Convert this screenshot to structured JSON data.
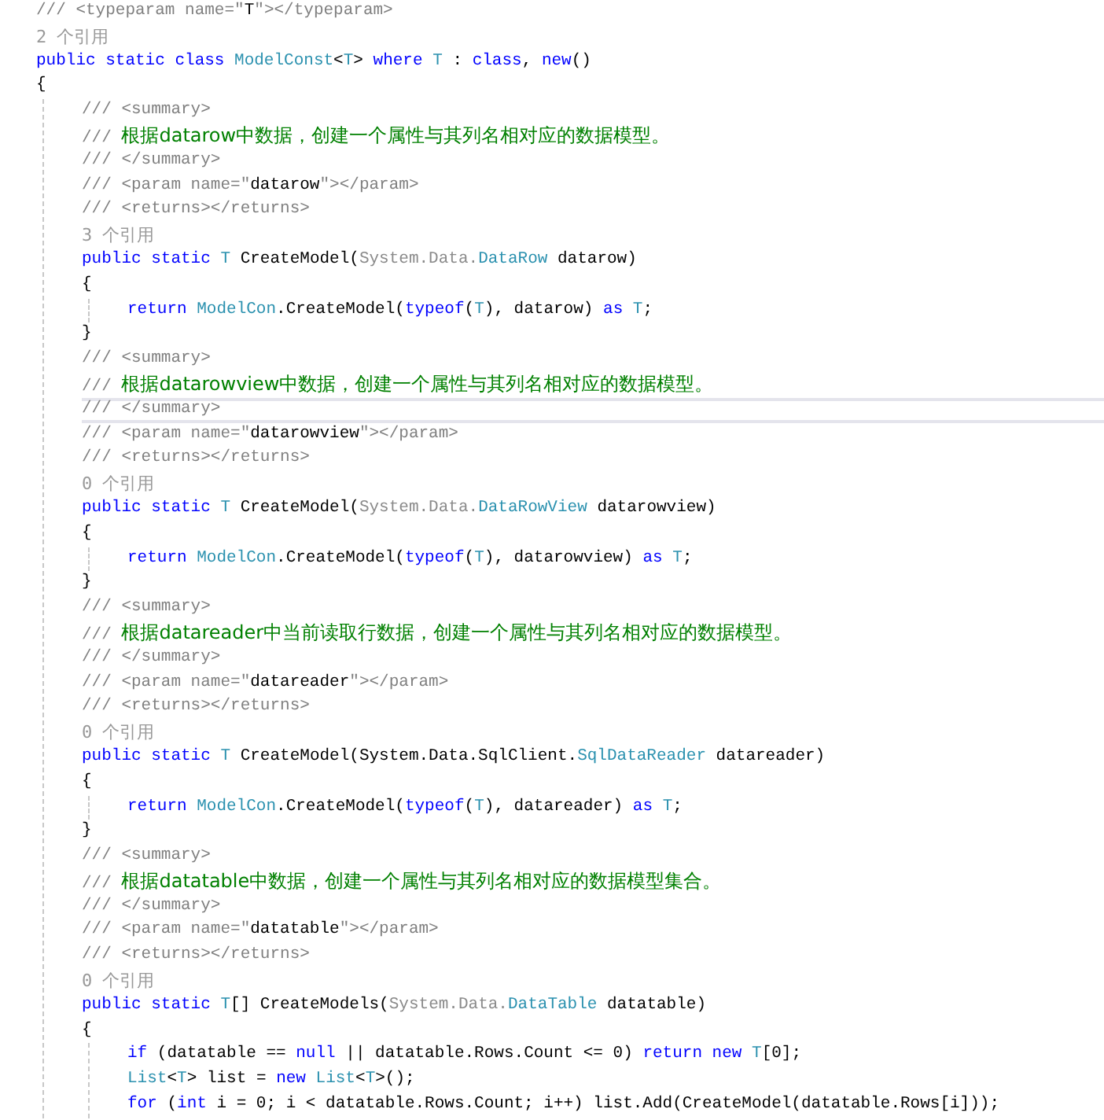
{
  "editor": {
    "lines": [
      {
        "kind": "code",
        "current": false,
        "tokens": [
          {
            "kind": "doc",
            "text": "/// <typeparam name=\""
          },
          {
            "kind": "plain",
            "text": "T"
          },
          {
            "kind": "doc",
            "text": "\"></typeparam>"
          }
        ]
      },
      {
        "kind": "ref",
        "current": false,
        "text": "2 个引用"
      },
      {
        "kind": "code",
        "current": false,
        "tokens": [
          {
            "kind": "kw",
            "text": "public static class "
          },
          {
            "kind": "type",
            "text": "ModelConst"
          },
          {
            "kind": "plain",
            "text": "<"
          },
          {
            "kind": "type",
            "text": "T"
          },
          {
            "kind": "plain",
            "text": "> "
          },
          {
            "kind": "kw",
            "text": "where "
          },
          {
            "kind": "type",
            "text": "T"
          },
          {
            "kind": "plain",
            "text": " : "
          },
          {
            "kind": "kw",
            "text": "class"
          },
          {
            "kind": "plain",
            "text": ", "
          },
          {
            "kind": "kw",
            "text": "new"
          },
          {
            "kind": "plain",
            "text": "()"
          }
        ]
      },
      {
        "kind": "code",
        "current": false,
        "tokens": [
          {
            "kind": "plain",
            "text": "{"
          }
        ]
      },
      {
        "kind": "block",
        "children": [
          {
            "kind": "code",
            "current": false,
            "tokens": [
              {
                "kind": "doc",
                "text": "/// <summary>"
              }
            ]
          },
          {
            "kind": "code",
            "current": false,
            "tokens": [
              {
                "kind": "doc",
                "text": "/// "
              },
              {
                "kind": "comment",
                "text": "根据datarow中数据，创建一个属性与其列名相对应的数据模型。"
              }
            ]
          },
          {
            "kind": "code",
            "current": false,
            "tokens": [
              {
                "kind": "doc",
                "text": "/// </summary>"
              }
            ]
          },
          {
            "kind": "code",
            "current": false,
            "tokens": [
              {
                "kind": "doc",
                "text": "/// <param name=\""
              },
              {
                "kind": "plain",
                "text": "datarow"
              },
              {
                "kind": "doc",
                "text": "\"></param>"
              }
            ]
          },
          {
            "kind": "code",
            "current": false,
            "tokens": [
              {
                "kind": "doc",
                "text": "/// <returns></returns>"
              }
            ]
          },
          {
            "kind": "ref",
            "current": false,
            "text": "3 个引用"
          },
          {
            "kind": "code",
            "current": false,
            "tokens": [
              {
                "kind": "kw",
                "text": "public static "
              },
              {
                "kind": "type",
                "text": "T"
              },
              {
                "kind": "plain",
                "text": " CreateModel("
              },
              {
                "kind": "faded",
                "text": "System.Data."
              },
              {
                "kind": "type",
                "text": "DataRow"
              },
              {
                "kind": "plain",
                "text": " datarow)"
              }
            ]
          },
          {
            "kind": "code",
            "current": false,
            "tokens": [
              {
                "kind": "plain",
                "text": "{"
              }
            ]
          },
          {
            "kind": "block",
            "children": [
              {
                "kind": "code",
                "current": false,
                "tokens": [
                  {
                    "kind": "kw",
                    "text": "return "
                  },
                  {
                    "kind": "type",
                    "text": "ModelCon"
                  },
                  {
                    "kind": "plain",
                    "text": ".CreateModel("
                  },
                  {
                    "kind": "kw",
                    "text": "typeof"
                  },
                  {
                    "kind": "plain",
                    "text": "("
                  },
                  {
                    "kind": "type",
                    "text": "T"
                  },
                  {
                    "kind": "plain",
                    "text": "), datarow) "
                  },
                  {
                    "kind": "kw",
                    "text": "as "
                  },
                  {
                    "kind": "type",
                    "text": "T"
                  },
                  {
                    "kind": "plain",
                    "text": ";"
                  }
                ]
              }
            ]
          },
          {
            "kind": "code",
            "current": false,
            "tokens": [
              {
                "kind": "plain",
                "text": "}"
              }
            ]
          },
          {
            "kind": "code",
            "current": false,
            "tokens": [
              {
                "kind": "doc",
                "text": "/// <summary>"
              }
            ]
          },
          {
            "kind": "code",
            "current": false,
            "tokens": [
              {
                "kind": "doc",
                "text": "/// "
              },
              {
                "kind": "comment",
                "text": "根据datarowview中数据，创建一个属性与其列名相对应的数据模型。"
              }
            ]
          },
          {
            "kind": "code",
            "current": true,
            "tokens": [
              {
                "kind": "doc",
                "text": "/// </summary>"
              }
            ]
          },
          {
            "kind": "code",
            "current": false,
            "tokens": [
              {
                "kind": "doc",
                "text": "/// <param name=\""
              },
              {
                "kind": "plain",
                "text": "datarowview"
              },
              {
                "kind": "doc",
                "text": "\"></param>"
              }
            ]
          },
          {
            "kind": "code",
            "current": false,
            "tokens": [
              {
                "kind": "doc",
                "text": "/// <returns></returns>"
              }
            ]
          },
          {
            "kind": "ref",
            "current": false,
            "text": "0 个引用"
          },
          {
            "kind": "code",
            "current": false,
            "tokens": [
              {
                "kind": "kw",
                "text": "public static "
              },
              {
                "kind": "type",
                "text": "T"
              },
              {
                "kind": "plain",
                "text": " CreateModel("
              },
              {
                "kind": "faded",
                "text": "System.Data."
              },
              {
                "kind": "type",
                "text": "DataRowView"
              },
              {
                "kind": "plain",
                "text": " datarowview)"
              }
            ]
          },
          {
            "kind": "code",
            "current": false,
            "tokens": [
              {
                "kind": "plain",
                "text": "{"
              }
            ]
          },
          {
            "kind": "block",
            "children": [
              {
                "kind": "code",
                "current": false,
                "tokens": [
                  {
                    "kind": "kw",
                    "text": "return "
                  },
                  {
                    "kind": "type",
                    "text": "ModelCon"
                  },
                  {
                    "kind": "plain",
                    "text": ".CreateModel("
                  },
                  {
                    "kind": "kw",
                    "text": "typeof"
                  },
                  {
                    "kind": "plain",
                    "text": "("
                  },
                  {
                    "kind": "type",
                    "text": "T"
                  },
                  {
                    "kind": "plain",
                    "text": "), datarowview) "
                  },
                  {
                    "kind": "kw",
                    "text": "as "
                  },
                  {
                    "kind": "type",
                    "text": "T"
                  },
                  {
                    "kind": "plain",
                    "text": ";"
                  }
                ]
              }
            ]
          },
          {
            "kind": "code",
            "current": false,
            "tokens": [
              {
                "kind": "plain",
                "text": "}"
              }
            ]
          },
          {
            "kind": "code",
            "current": false,
            "tokens": [
              {
                "kind": "doc",
                "text": "/// <summary>"
              }
            ]
          },
          {
            "kind": "code",
            "current": false,
            "tokens": [
              {
                "kind": "doc",
                "text": "/// "
              },
              {
                "kind": "comment",
                "text": "根据datareader中当前读取行数据，创建一个属性与其列名相对应的数据模型。"
              }
            ]
          },
          {
            "kind": "code",
            "current": false,
            "tokens": [
              {
                "kind": "doc",
                "text": "/// </summary>"
              }
            ]
          },
          {
            "kind": "code",
            "current": false,
            "tokens": [
              {
                "kind": "doc",
                "text": "/// <param name=\""
              },
              {
                "kind": "plain",
                "text": "datareader"
              },
              {
                "kind": "doc",
                "text": "\"></param>"
              }
            ]
          },
          {
            "kind": "code",
            "current": false,
            "tokens": [
              {
                "kind": "doc",
                "text": "/// <returns></returns>"
              }
            ]
          },
          {
            "kind": "ref",
            "current": false,
            "text": "0 个引用"
          },
          {
            "kind": "code",
            "current": false,
            "tokens": [
              {
                "kind": "kw",
                "text": "public static "
              },
              {
                "kind": "type",
                "text": "T"
              },
              {
                "kind": "plain",
                "text": " CreateModel(System.Data.SqlClient."
              },
              {
                "kind": "type",
                "text": "SqlDataReader"
              },
              {
                "kind": "plain",
                "text": " datareader)"
              }
            ]
          },
          {
            "kind": "code",
            "current": false,
            "tokens": [
              {
                "kind": "plain",
                "text": "{"
              }
            ]
          },
          {
            "kind": "block",
            "children": [
              {
                "kind": "code",
                "current": false,
                "tokens": [
                  {
                    "kind": "kw",
                    "text": "return "
                  },
                  {
                    "kind": "type",
                    "text": "ModelCon"
                  },
                  {
                    "kind": "plain",
                    "text": ".CreateModel("
                  },
                  {
                    "kind": "kw",
                    "text": "typeof"
                  },
                  {
                    "kind": "plain",
                    "text": "("
                  },
                  {
                    "kind": "type",
                    "text": "T"
                  },
                  {
                    "kind": "plain",
                    "text": "), datareader) "
                  },
                  {
                    "kind": "kw",
                    "text": "as "
                  },
                  {
                    "kind": "type",
                    "text": "T"
                  },
                  {
                    "kind": "plain",
                    "text": ";"
                  }
                ]
              }
            ]
          },
          {
            "kind": "code",
            "current": false,
            "tokens": [
              {
                "kind": "plain",
                "text": "}"
              }
            ]
          },
          {
            "kind": "code",
            "current": false,
            "tokens": [
              {
                "kind": "doc",
                "text": "/// <summary>"
              }
            ]
          },
          {
            "kind": "code",
            "current": false,
            "tokens": [
              {
                "kind": "doc",
                "text": "/// "
              },
              {
                "kind": "comment",
                "text": "根据datatable中数据，创建一个属性与其列名相对应的数据模型集合。"
              }
            ]
          },
          {
            "kind": "code",
            "current": false,
            "tokens": [
              {
                "kind": "doc",
                "text": "/// </summary>"
              }
            ]
          },
          {
            "kind": "code",
            "current": false,
            "tokens": [
              {
                "kind": "doc",
                "text": "/// <param name=\""
              },
              {
                "kind": "plain",
                "text": "datatable"
              },
              {
                "kind": "doc",
                "text": "\"></param>"
              }
            ]
          },
          {
            "kind": "code",
            "current": false,
            "tokens": [
              {
                "kind": "doc",
                "text": "/// <returns></returns>"
              }
            ]
          },
          {
            "kind": "ref",
            "current": false,
            "text": "0 个引用"
          },
          {
            "kind": "code",
            "current": false,
            "tokens": [
              {
                "kind": "kw",
                "text": "public static "
              },
              {
                "kind": "type",
                "text": "T"
              },
              {
                "kind": "plain",
                "text": "[] CreateModels("
              },
              {
                "kind": "faded",
                "text": "System.Data."
              },
              {
                "kind": "type",
                "text": "DataTable"
              },
              {
                "kind": "plain",
                "text": " datatable)"
              }
            ]
          },
          {
            "kind": "code",
            "current": false,
            "tokens": [
              {
                "kind": "plain",
                "text": "{"
              }
            ]
          },
          {
            "kind": "block",
            "children": [
              {
                "kind": "code",
                "current": false,
                "tokens": [
                  {
                    "kind": "kw",
                    "text": "if"
                  },
                  {
                    "kind": "plain",
                    "text": " (datatable == "
                  },
                  {
                    "kind": "kw",
                    "text": "null"
                  },
                  {
                    "kind": "plain",
                    "text": " || datatable.Rows.Count <= 0) "
                  },
                  {
                    "kind": "kw",
                    "text": "return new "
                  },
                  {
                    "kind": "type",
                    "text": "T"
                  },
                  {
                    "kind": "plain",
                    "text": "[0];"
                  }
                ]
              },
              {
                "kind": "code",
                "current": false,
                "tokens": [
                  {
                    "kind": "type",
                    "text": "List"
                  },
                  {
                    "kind": "plain",
                    "text": "<"
                  },
                  {
                    "kind": "type",
                    "text": "T"
                  },
                  {
                    "kind": "plain",
                    "text": "> list = "
                  },
                  {
                    "kind": "kw",
                    "text": "new "
                  },
                  {
                    "kind": "type",
                    "text": "List"
                  },
                  {
                    "kind": "plain",
                    "text": "<"
                  },
                  {
                    "kind": "type",
                    "text": "T"
                  },
                  {
                    "kind": "plain",
                    "text": ">();"
                  }
                ]
              },
              {
                "kind": "code",
                "current": false,
                "tokens": [
                  {
                    "kind": "kw",
                    "text": "for"
                  },
                  {
                    "kind": "plain",
                    "text": " ("
                  },
                  {
                    "kind": "kw",
                    "text": "int"
                  },
                  {
                    "kind": "plain",
                    "text": " i = 0; i < datatable.Rows.Count; i++) list.Add(CreateModel(datatable.Rows[i]));"
                  }
                ]
              }
            ]
          }
        ]
      }
    ]
  }
}
